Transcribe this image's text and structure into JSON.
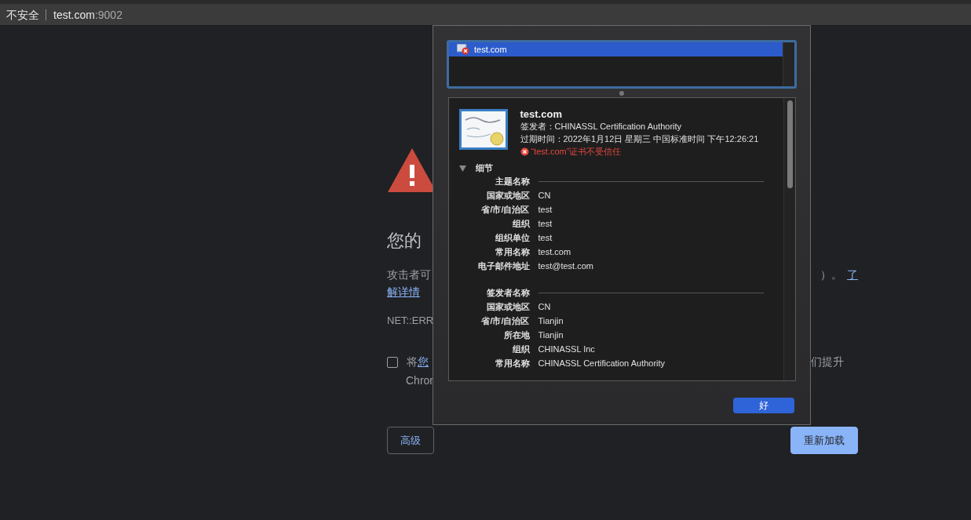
{
  "address_bar": {
    "security": "不安全",
    "host": "test.com",
    "port": ":9002"
  },
  "interstitial": {
    "heading": "您的",
    "description_start": "攻击者可",
    "description_end": "）。",
    "learn_more_start": "了",
    "learn_more_end": "解详情",
    "error_code": "NET::ERR",
    "report": {
      "checked": false,
      "prefix": "将",
      "link": "您",
      "end": "们提升",
      "second_line": "Chror"
    },
    "buttons": [
      {
        "label": "高级",
        "kind": "secondary"
      },
      {
        "label": "重新加载",
        "kind": "primary"
      }
    ]
  },
  "certificate_dialog": {
    "list": [
      {
        "name": "test.com",
        "selected": true
      }
    ],
    "cert": {
      "name": "test.com",
      "issuer": "签发者：CHINASSL Certification Authority",
      "expires": "过期时间：2022年1月12日 星期三 中国标准时间 下午12:26:21",
      "trust_error": "“test.com”证书不受信任"
    },
    "details": {
      "label": "细节",
      "expanded": true,
      "sections": [
        {
          "title": "主题名称",
          "fields": [
            {
              "label": "国家或地区",
              "value": "CN"
            },
            {
              "label": "省/市/自治区",
              "value": "test"
            },
            {
              "label": "组织",
              "value": "test"
            },
            {
              "label": "组织单位",
              "value": "test"
            },
            {
              "label": "常用名称",
              "value": "test.com"
            },
            {
              "label": "电子邮件地址",
              "value": "test@test.com"
            }
          ]
        },
        {
          "title": "签发者名称",
          "fields": [
            {
              "label": "国家或地区",
              "value": "CN"
            },
            {
              "label": "省/市/自治区",
              "value": "Tianjin"
            },
            {
              "label": "所在地",
              "value": "Tianjin"
            },
            {
              "label": "组织",
              "value": "CHINASSL Inc"
            },
            {
              "label": "常用名称",
              "value": "CHINASSL Certification Authority"
            }
          ]
        }
      ]
    },
    "ok_button": "好"
  }
}
